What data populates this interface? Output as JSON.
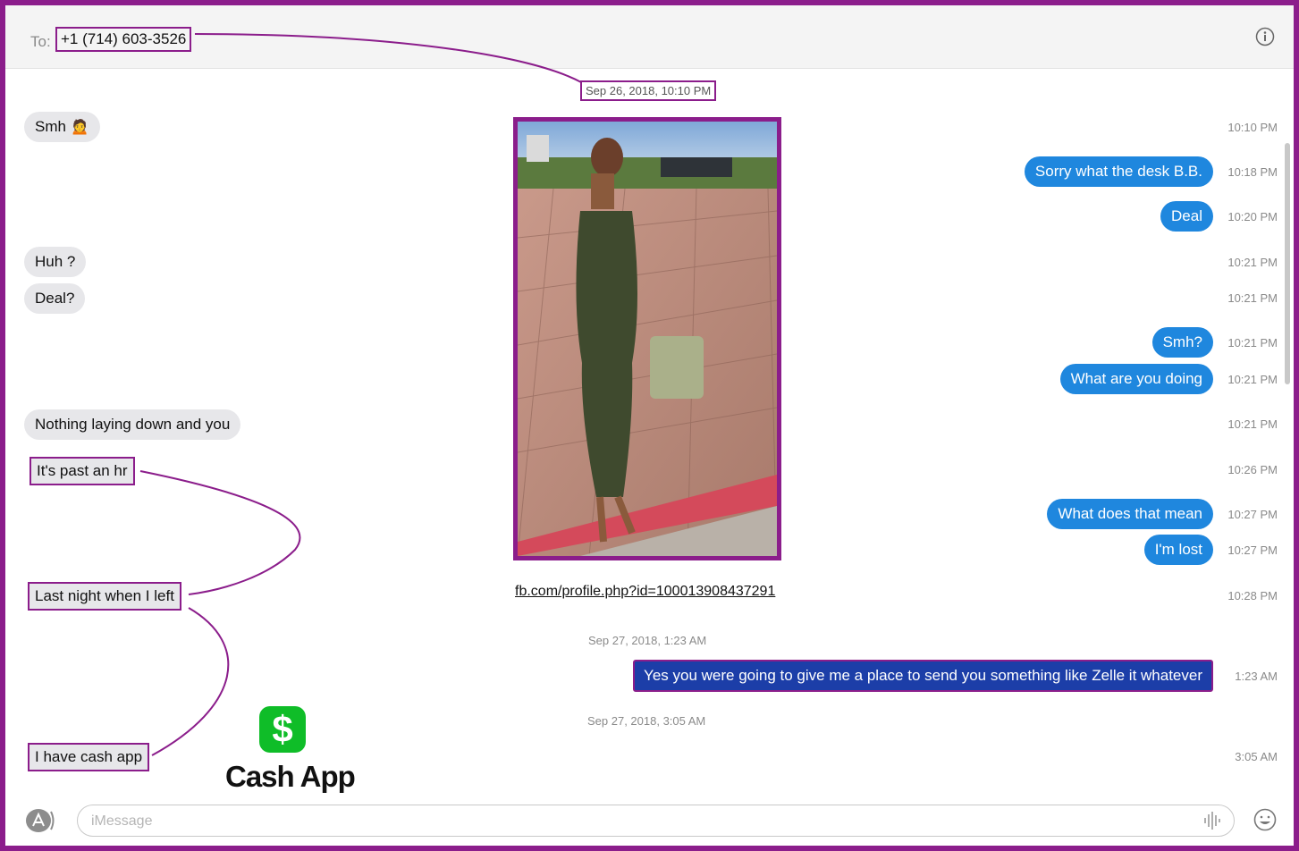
{
  "header": {
    "to_label": "To:",
    "recipient": "+1 (714) 603-3526"
  },
  "conversation": {
    "timestamps": {
      "first": "Sep 26, 2018, 10:10 PM",
      "second": "Sep 27, 2018, 1:23 AM",
      "third": "Sep 27, 2018, 3:05 AM"
    },
    "received": [
      {
        "text": "Smh 🙍"
      },
      {
        "text": "Huh ?"
      },
      {
        "text": "Deal?"
      },
      {
        "text": "Nothing laying down and you"
      },
      {
        "text": "It's past an hr"
      },
      {
        "text": "Last night when I left"
      },
      {
        "text": "I have cash app"
      }
    ],
    "sent": [
      {
        "text": "Sorry what the desk B.B."
      },
      {
        "text": "Deal"
      },
      {
        "text": "Smh?"
      },
      {
        "text": "What are you doing"
      },
      {
        "text": "What does that mean"
      },
      {
        "text": "I'm lost"
      },
      {
        "text": "Yes you were going to give me a place to send you something like Zelle it whatever"
      }
    ],
    "times": [
      "10:10 PM",
      "10:18 PM",
      "10:20 PM",
      "10:21 PM",
      "10:21 PM",
      "10:21 PM",
      "10:21 PM",
      "10:21 PM",
      "10:26 PM",
      "10:27 PM",
      "10:27 PM",
      "10:28 PM",
      "1:23 AM",
      "3:05 AM"
    ],
    "profile_link": "fb.com/profile.php?id=100013908437291"
  },
  "cash_app": {
    "symbol": "$",
    "label": "Cash App"
  },
  "compose": {
    "placeholder": "iMessage"
  },
  "colors": {
    "annotation": "#8b1d8b",
    "sent_bubble": "#1f87de",
    "received_bubble": "#e7e7ea",
    "cash_app_green": "#0fbd28"
  }
}
